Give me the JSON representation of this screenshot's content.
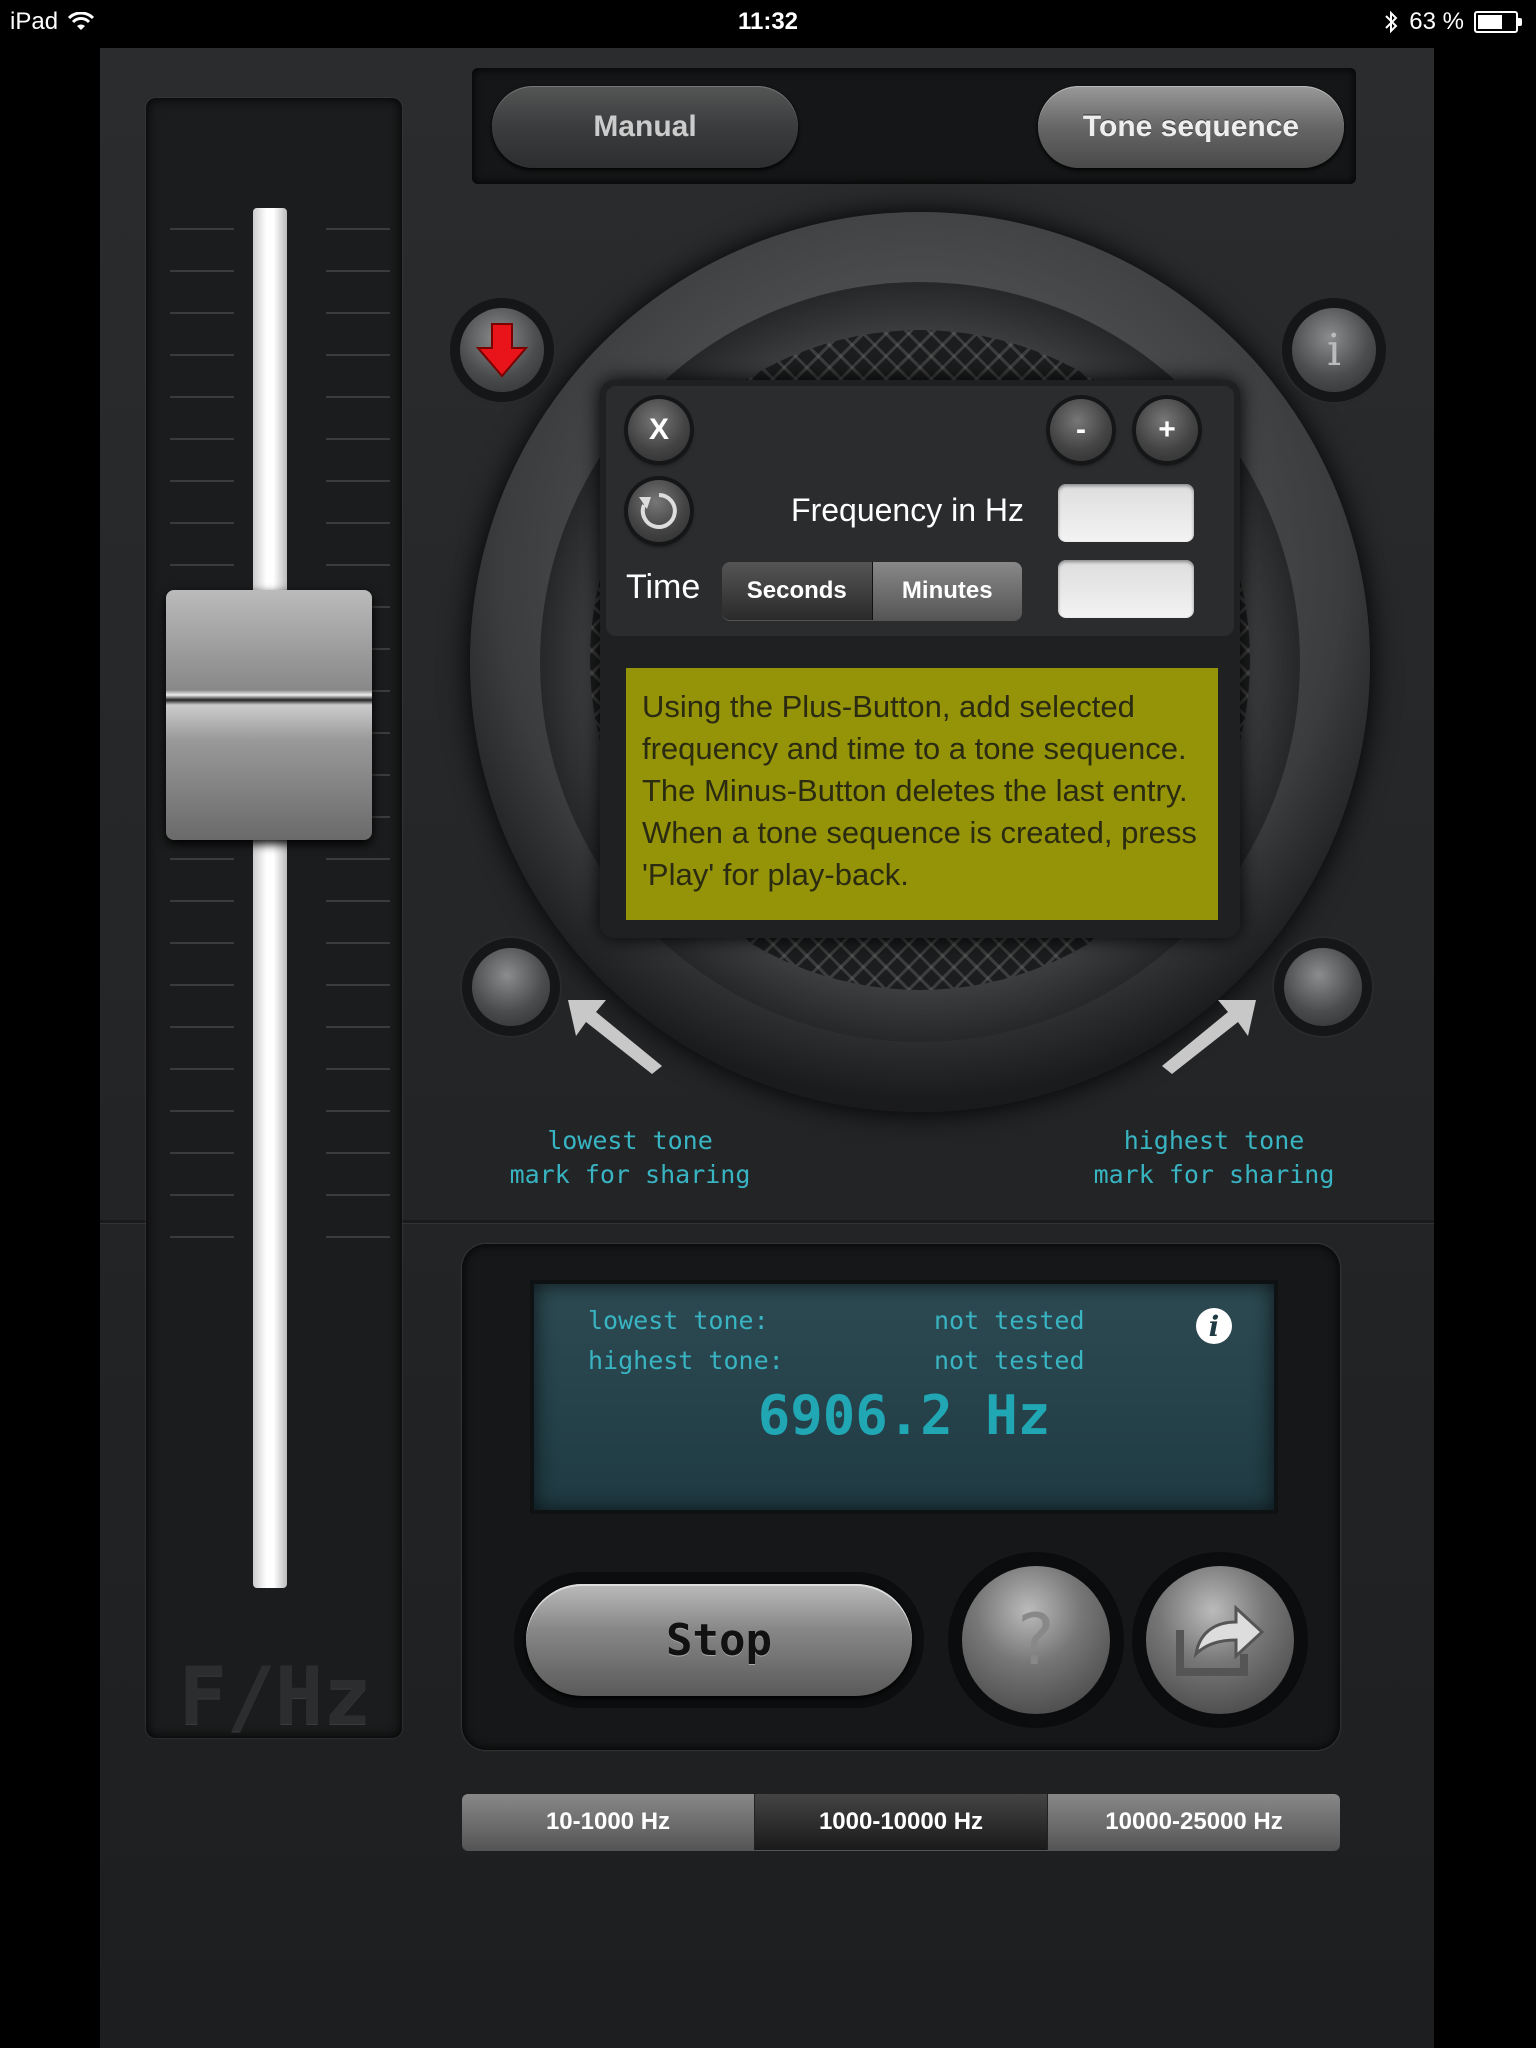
{
  "status_bar": {
    "device": "iPad",
    "time": "11:32",
    "battery": "63 %"
  },
  "mode_tabs": {
    "manual": "Manual",
    "tone_sequence": "Tone sequence"
  },
  "slider": {
    "axis_label": "F/Hz"
  },
  "speaker": {
    "info_label": "i"
  },
  "marks": {
    "lowest": "lowest tone\nmark for sharing",
    "highest": "highest tone\nmark for sharing"
  },
  "tone_sequence_panel": {
    "close_label": "X",
    "minus_label": "-",
    "plus_label": "+",
    "frequency_label": "Frequency in Hz",
    "frequency_value": "",
    "time_label": "Time",
    "time_units": [
      "Seconds",
      "Minutes"
    ],
    "time_selected": "Minutes",
    "time_value": "",
    "help_text": "Using the Plus-Button,  add selected frequency and time to a tone sequence. The Minus-Button deletes the last entry. When a tone sequence is created, press 'Play' for play-back."
  },
  "display": {
    "lowest_tone_label": "lowest tone:",
    "lowest_tone_value": "not tested",
    "highest_tone_label": "highest tone:",
    "highest_tone_value": "not tested",
    "frequency": "6906.2 Hz",
    "info_label": "i"
  },
  "controls": {
    "stop_label": "Stop",
    "help_label": "?"
  },
  "ranges": {
    "items": [
      "10-1000 Hz",
      "1000-10000 Hz",
      "10000-25000 Hz"
    ],
    "selected": "1000-10000 Hz"
  },
  "colors": {
    "accent_cyan": "#39b4c2",
    "help_box": "#959408",
    "download_arrow": "#e8141a"
  }
}
